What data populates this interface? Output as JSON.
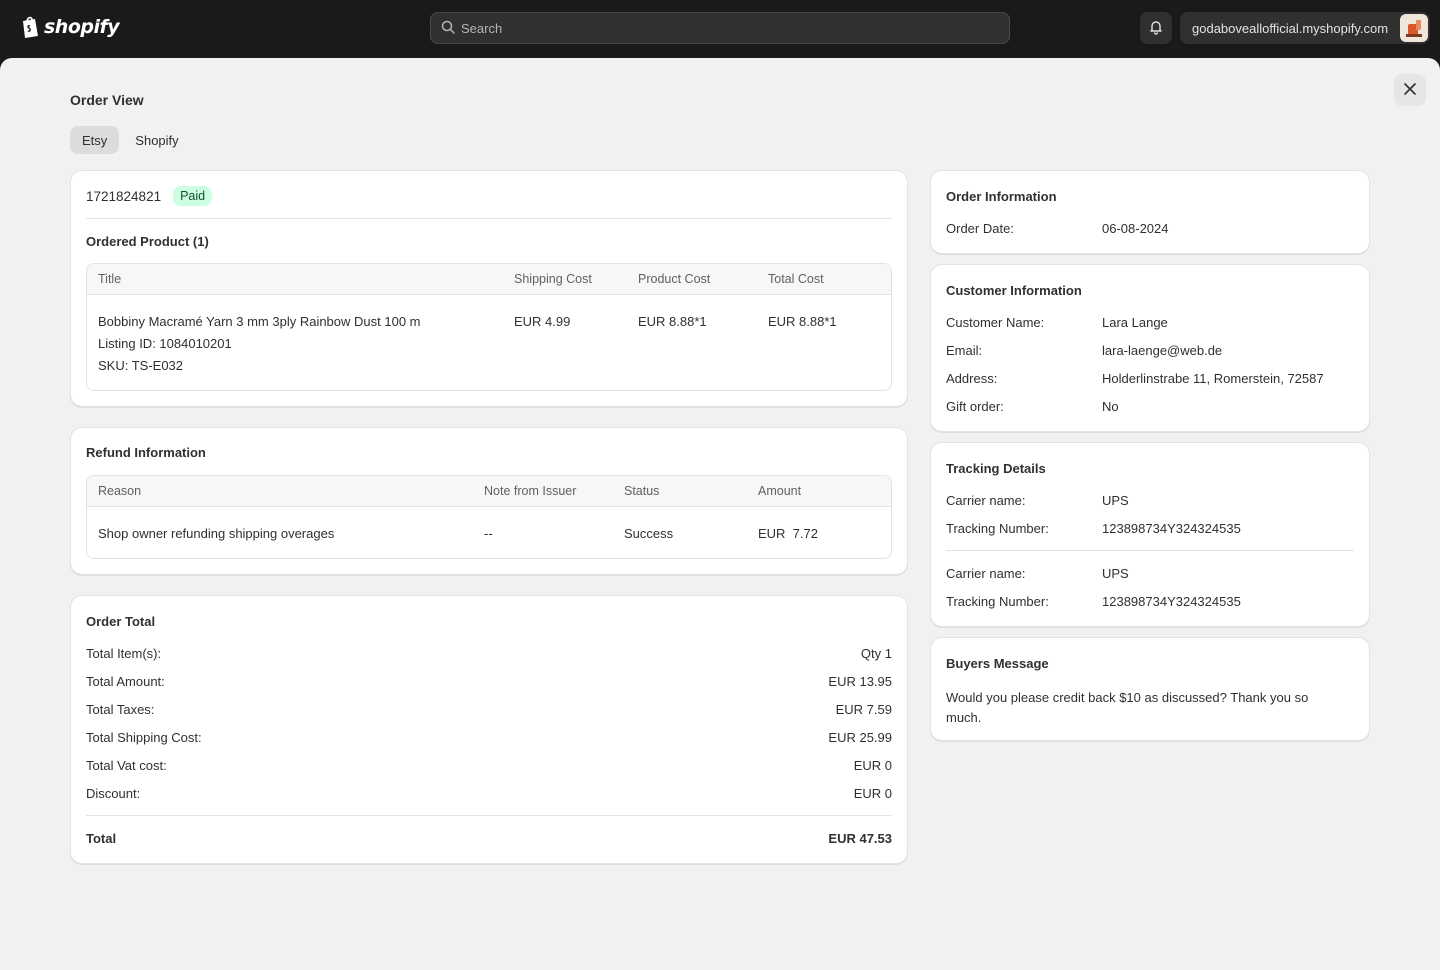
{
  "topbar": {
    "logo_text": "shopify",
    "search_placeholder": "Search",
    "store_name": "godaboveallofficial.myshopify.com"
  },
  "page": {
    "title": "Order View",
    "tabs": [
      {
        "label": "Etsy",
        "active": true
      },
      {
        "label": "Shopify",
        "active": false
      }
    ]
  },
  "order": {
    "id": "1721824821",
    "status_badge": "Paid",
    "ordered_product_heading": "Ordered Product (1)",
    "columns": [
      "Title",
      "Shipping Cost",
      "Product Cost",
      "Total Cost"
    ],
    "product": {
      "title": "Bobbiny Macramé Yarn 3 mm 3ply Rainbow Dust 100 m",
      "listing_id": "Listing ID: 1084010201",
      "sku": "SKU: TS-E032",
      "shipping_cost": "EUR 4.99",
      "product_cost": "EUR 8.88*1",
      "total_cost": "EUR 8.88*1"
    }
  },
  "refund": {
    "heading": "Refund Information",
    "columns": [
      "Reason",
      "Note from Issuer",
      "Status",
      "Amount"
    ],
    "row": {
      "reason": "Shop owner refunding shipping overages",
      "note": "--",
      "status": "Success",
      "amount": "EUR  7.72"
    }
  },
  "totals": {
    "heading": "Order Total",
    "rows": [
      {
        "label": "Total Item(s):",
        "value": "Qty 1"
      },
      {
        "label": "Total Amount:",
        "value": "EUR 13.95"
      },
      {
        "label": "Total Taxes:",
        "value": "EUR 7.59"
      },
      {
        "label": "Total Shipping Cost:",
        "value": "EUR 25.99"
      },
      {
        "label": "Total Vat cost:",
        "value": "EUR 0"
      },
      {
        "label": "Discount:",
        "value": "EUR 0"
      }
    ],
    "total_label": "Total",
    "total_value": "EUR 47.53"
  },
  "order_info": {
    "heading": "Order Information",
    "date_label": "Order Date:",
    "date_value": "06-08-2024"
  },
  "customer": {
    "heading": "Customer Information",
    "rows": [
      {
        "label": "Customer Name:",
        "value": "Lara Lange"
      },
      {
        "label": "Email:",
        "value": "lara-laenge@web.de"
      },
      {
        "label": "Address:",
        "value": "Holderlinstrabe 11, Romerstein, 72587"
      },
      {
        "label": "Gift order:",
        "value": "No"
      }
    ]
  },
  "tracking": {
    "heading": "Tracking Details",
    "entries": [
      {
        "carrier_label": "Carrier name:",
        "carrier": "UPS",
        "number_label": "Tracking Number:",
        "number": "123898734Y324324535"
      },
      {
        "carrier_label": "Carrier name:",
        "carrier": "UPS",
        "number_label": "Tracking Number:",
        "number": "123898734Y324324535"
      }
    ]
  },
  "buyers_message": {
    "heading": "Buyers Message",
    "text": "Would you please credit back $10 as discussed? Thank you so much."
  },
  "colors": {
    "topbar_bg": "#1a1a1a",
    "panel_bg": "#f1f1f1",
    "paid_badge_bg": "#cdfee1",
    "paid_badge_text": "#0c5132"
  },
  "icons": [
    "shopify-bag-icon",
    "search-icon",
    "bell-icon",
    "store-avatar",
    "close-icon"
  ]
}
